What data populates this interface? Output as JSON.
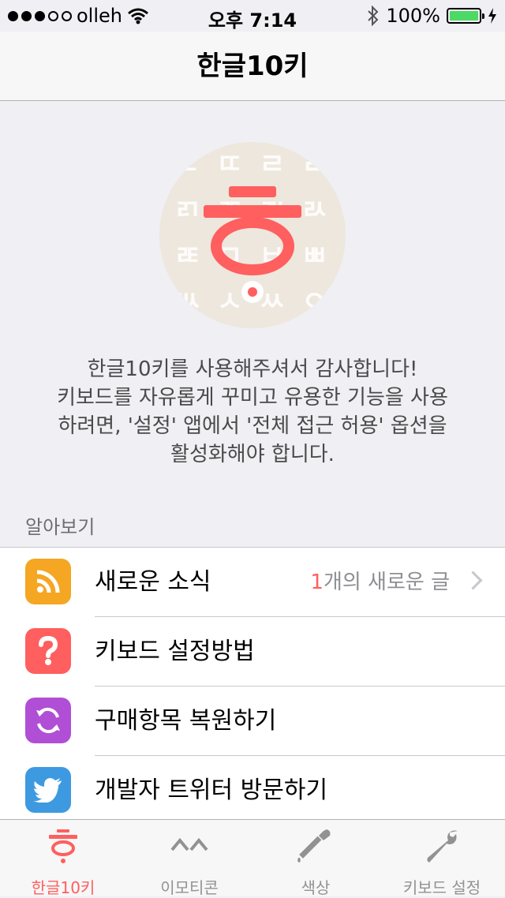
{
  "status_bar": {
    "carrier": "olleh",
    "time": "오후 7:14",
    "battery": "100%",
    "signal_bars_filled": 3,
    "signal_bars_total": 5
  },
  "nav": {
    "title": "한글10키"
  },
  "logo": {
    "glyph": "ㄷ ㄸ ㄹ ㄹ ㄺ ㄻ ㄼ ㄽ ㄾ ㅁ ㅂ ㅃ ㅄ ㅅ ㅆ ㅇ ㅈ"
  },
  "description": {
    "lines": [
      "한글10키를 사용해주셔서 감사합니다!",
      "키보드를 자유롭게 꾸미고 유용한 기능을 사용",
      "하려면, '설정' 앱에서 '전체 접근 허용' 옵션을",
      "활성화해야 합니다."
    ]
  },
  "section": {
    "header": "알아보기"
  },
  "list": {
    "items": [
      {
        "label": "새로운 소식",
        "icon": "rss-icon",
        "color": "#f5a623",
        "detail_count": "1",
        "detail_text": "개의 새로운 글"
      },
      {
        "label": "키보드 설정방법",
        "icon": "question-icon",
        "color": "#ff5f5f"
      },
      {
        "label": "구매항목 복원하기",
        "icon": "restore-icon",
        "color": "#b04fd6"
      },
      {
        "label": "개발자 트위터 방문하기",
        "icon": "twitter-icon",
        "color": "#3e9ae0"
      }
    ]
  },
  "tabbar": {
    "tabs": [
      {
        "label": "한글10키",
        "icon": "hieut-icon",
        "active": true
      },
      {
        "label": "이모티콘",
        "icon": "emoticon-icon",
        "active": false
      },
      {
        "label": "색상",
        "icon": "eyedropper-icon",
        "active": false
      },
      {
        "label": "키보드 설정",
        "icon": "wrench-icon",
        "active": false
      }
    ]
  },
  "colors": {
    "accent": "#ff5f5f",
    "battery": "#4cd964",
    "inactive": "#929292"
  }
}
